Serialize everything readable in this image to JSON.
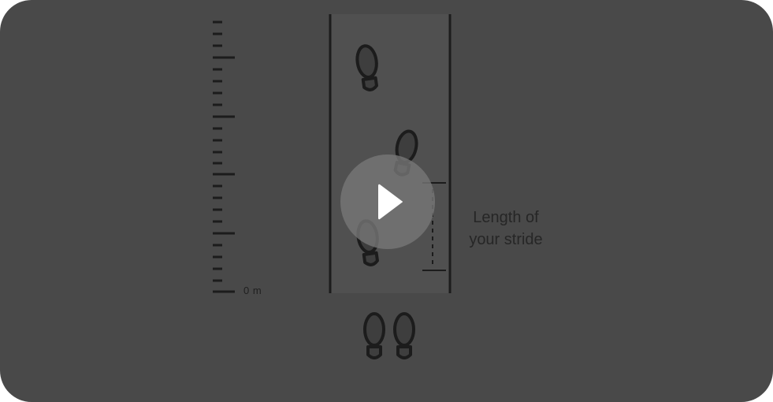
{
  "video": {
    "ruler_zero_label": "0 m",
    "stride_label_line1": "Length of",
    "stride_label_line2": "your stride",
    "play_icon": "play-icon",
    "footprint_icon": "shoe-print-icon"
  }
}
